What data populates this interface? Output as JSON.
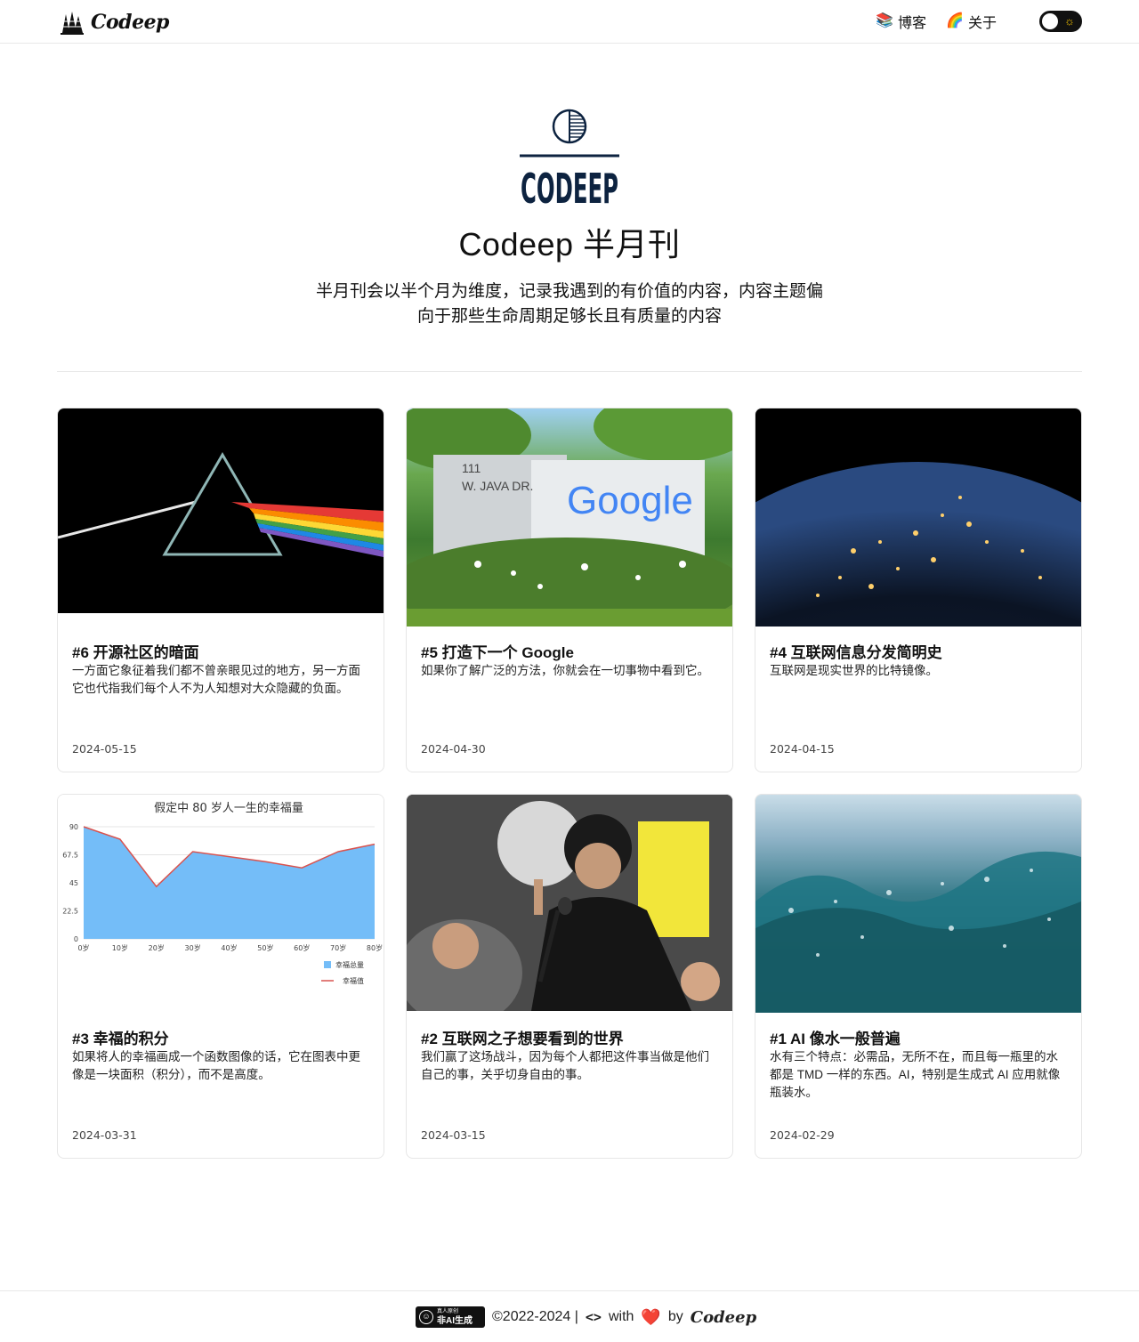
{
  "header": {
    "brand": "Codeep",
    "nav": [
      {
        "emoji": "📚",
        "label": "博客"
      },
      {
        "emoji": "🌈",
        "label": "关于"
      }
    ],
    "theme_icon": "sun-icon"
  },
  "hero": {
    "logo_text": "CODEEP",
    "title": "Codeep 半月刊",
    "description": "半月刊会以半个月为维度，记录我遇到的有价值的内容，内容主题偏向于那些生命周期足够长且有质量的内容"
  },
  "posts": [
    {
      "title": "#6 开源社区的暗面",
      "desc": "一方面它象征着我们都不曾亲眼见过的地方，另一方面它也代指我们每个人不为人知想对大众隐藏的负面。",
      "date": "2024-05-15",
      "image": "prism-rainbow"
    },
    {
      "title": "#5 打造下一个 Google",
      "desc": "如果你了解广泛的方法，你就会在一切事物中看到它。",
      "date": "2024-04-30",
      "image": "google-sign",
      "sign_address_line1": "111",
      "sign_address_line2": "W. JAVA DR.",
      "sign_brand": "Google"
    },
    {
      "title": "#4 互联网信息分发简明史",
      "desc": "互联网是现实世界的比特镜像。",
      "date": "2024-04-15",
      "image": "earth-night"
    },
    {
      "title": "#3 幸福的积分",
      "desc": "如果将人的幸福画成一个函数图像的话，它在图表中更像是一块面积（积分），而不是高度。",
      "date": "2024-03-31",
      "image": "happiness-chart"
    },
    {
      "title": "#2 互联网之子想要看到的世界",
      "desc": "我们赢了这场战斗，因为每个人都把这件事当做是他们自己的事，关乎切身自由的事。",
      "date": "2024-03-15",
      "image": "speaker-rally"
    },
    {
      "title": "#1 AI 像水一般普遍",
      "desc": "水有三个特点：必需品，无所不在，而且每一瓶里的水都是 TMD 一样的东西。AI，特别是生成式 AI 应用就像瓶装水。",
      "date": "2024-02-29",
      "image": "water-wave"
    }
  ],
  "chart_data": {
    "type": "area",
    "title": "假定中 80 岁人一生的幸福量",
    "categories": [
      "0岁",
      "10岁",
      "20岁",
      "30岁",
      "40岁",
      "50岁",
      "60岁",
      "70岁",
      "80岁"
    ],
    "series": [
      {
        "name": "幸福总量",
        "values": [
          90,
          80,
          42,
          70,
          66,
          62,
          57,
          70,
          76
        ]
      },
      {
        "name": "幸福值",
        "values": [
          90,
          80,
          42,
          70,
          66,
          62,
          57,
          70,
          76
        ]
      }
    ],
    "yticks": [
      "0",
      "22.5",
      "45",
      "67.5",
      "90"
    ],
    "ylim": [
      0,
      90
    ],
    "colors": {
      "area": "#74bdf8",
      "line": "#d9534f"
    }
  },
  "footer": {
    "badge_small": "真人原创",
    "badge_big": "非AI生成",
    "copyright": "©2022-2024 |",
    "code_glyph": "<>",
    "with": "with",
    "heart": "❤️",
    "by": "by",
    "brand": "Codeep"
  }
}
